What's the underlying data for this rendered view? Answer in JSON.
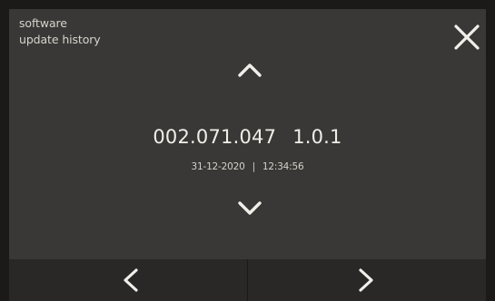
{
  "header": {
    "title_line_1": "software",
    "title_line_2": "update history"
  },
  "record": {
    "version_primary": "002.071.047",
    "version_secondary": "1.0.1",
    "date": "31-12-2020",
    "separator": "|",
    "time": "12:34:56"
  },
  "icons": {
    "close": "close-icon",
    "up": "chevron-up-icon",
    "down": "chevron-down-icon",
    "previous": "chevron-left-icon",
    "next": "chevron-right-icon"
  },
  "colors": {
    "background": "#1b1a19",
    "panel": "#3a3836",
    "bottom_bar": "#2a2827",
    "primary_text": "#f1eee9",
    "secondary_text": "#d5d0ca"
  }
}
